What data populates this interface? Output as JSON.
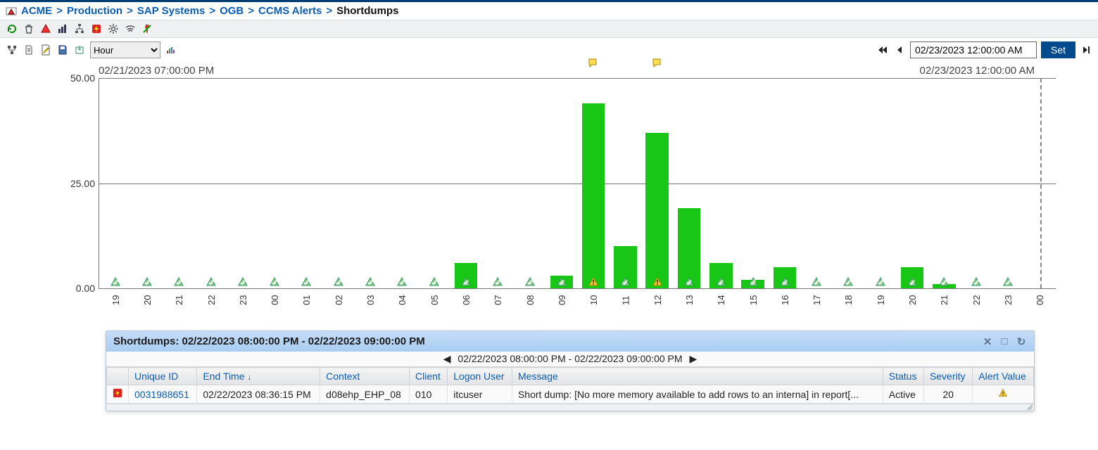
{
  "breadcrumb": {
    "items": [
      "ACME",
      "Production",
      "SAP Systems",
      "OGB",
      "CCMS Alerts"
    ],
    "current": "Shortdumps"
  },
  "timebar": {
    "interval_options": [
      "Hour"
    ],
    "interval_value": "Hour",
    "datetime_value": "02/23/2023 12:00:00 AM",
    "set_label": "Set"
  },
  "chart_header": {
    "start": "02/21/2023 07:00:00 PM",
    "end": "02/23/2023 12:00:00 AM"
  },
  "chart_data": {
    "type": "bar",
    "title": "",
    "xlabel": "",
    "ylabel": "",
    "ylim": [
      0,
      50
    ],
    "yticks": [
      0.0,
      25.0,
      50.0
    ],
    "categories": [
      "19",
      "20",
      "21",
      "22",
      "23",
      "00",
      "01",
      "02",
      "03",
      "04",
      "05",
      "06",
      "07",
      "08",
      "09",
      "10",
      "11",
      "12",
      "13",
      "14",
      "15",
      "16",
      "17",
      "18",
      "19",
      "20",
      "21",
      "22",
      "23",
      "00"
    ],
    "values": [
      0,
      0,
      0,
      0,
      0,
      0,
      0,
      0,
      0,
      0,
      0,
      6,
      0,
      0,
      3,
      44,
      10,
      37,
      19,
      6,
      2,
      5,
      0,
      0,
      0,
      5,
      1,
      0,
      0,
      0
    ],
    "markers": [
      "ok",
      "ok",
      "ok",
      "ok",
      "ok",
      "ok",
      "ok",
      "ok",
      "ok",
      "ok",
      "ok",
      "ok",
      "ok",
      "ok",
      "ok",
      "warn",
      "ok",
      "warn",
      "ok",
      "ok",
      "ok",
      "ok",
      "ok",
      "ok",
      "ok",
      "ok",
      "ok",
      "ok",
      "ok",
      null
    ],
    "note_flags": [
      false,
      false,
      false,
      false,
      false,
      false,
      false,
      false,
      false,
      false,
      false,
      false,
      false,
      false,
      false,
      true,
      false,
      true,
      false,
      false,
      false,
      false,
      false,
      false,
      false,
      false,
      false,
      false,
      false,
      false
    ]
  },
  "panel": {
    "title": "Shortdumps: 02/22/2023 08:00:00 PM - 02/22/2023 09:00:00 PM",
    "pager_text": "02/22/2023 08:00:00 PM - 02/22/2023 09:00:00 PM",
    "columns": [
      "Unique ID",
      "End Time",
      "Context",
      "Client",
      "Logon User",
      "Message",
      "Status",
      "Severity",
      "Alert Value"
    ],
    "sort_col": "End Time",
    "sort_dir": "desc",
    "rows": [
      {
        "icon": "alert-red",
        "unique_id": "0031988651",
        "end_time": "02/22/2023 08:36:15 PM",
        "context": "d08ehp_EHP_08",
        "client": "010",
        "logon_user": "itcuser",
        "message": "Short dump: [No more memory available to add rows to an interna] in report[...",
        "status": "Active",
        "severity": "20",
        "alert_value_icon": "warn"
      }
    ]
  }
}
